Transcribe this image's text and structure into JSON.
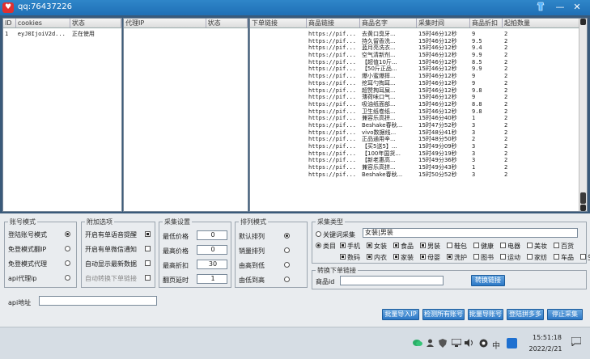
{
  "window": {
    "title": "qq:76437226",
    "logo": "♥"
  },
  "account_grid": {
    "headers": [
      "ID",
      "cookies",
      "状态"
    ],
    "rows": [
      [
        "1",
        "eyJ0IjoiV2d...",
        "正在使用"
      ]
    ]
  },
  "proxy_grid": {
    "headers": [
      "代理IP",
      "状态"
    ]
  },
  "product_grid": {
    "headers": [
      "下单链接",
      "商品链接",
      "商品名字",
      "采集时间",
      "商品折扣",
      "起拍数量"
    ],
    "rows": [
      [
        "",
        "https://pif...",
        "去黄口臭牙...",
        "15时46分12秒",
        "9",
        "2"
      ],
      [
        "",
        "https://pif...",
        "持久留香洗...",
        "15时46分12秒",
        "9.5",
        "2"
      ],
      [
        "",
        "https://pif...",
        "蓝月亮洗衣...",
        "15时46分12秒",
        "9.4",
        "2"
      ],
      [
        "",
        "https://pif...",
        "空气清新剂...",
        "15时46分12秒",
        "9.9",
        "2"
      ],
      [
        "",
        "https://pif...",
        "【超值10斤...",
        "15时46分12秒",
        "8.5",
        "2"
      ],
      [
        "",
        "https://pif...",
        "【50斤正品...",
        "15时46分12秒",
        "9.9",
        "2"
      ],
      [
        "",
        "https://pif...",
        "爆小蜜爆摔...",
        "15时46分12秒",
        "9",
        "2"
      ],
      [
        "",
        "https://pif...",
        "挖耳勺掏耳...",
        "15时46分12秒",
        "9",
        "2"
      ],
      [
        "",
        "https://pif...",
        "超赞掏耳屎...",
        "15时46分12秒",
        "9.8",
        "2"
      ],
      [
        "",
        "https://pif...",
        "薄荷味口气...",
        "15时46分12秒",
        "9",
        "2"
      ],
      [
        "",
        "https://pif...",
        "吸油纸面部...",
        "15时46分12秒",
        "8.8",
        "2"
      ],
      [
        "",
        "https://pif...",
        "卫生纸卷纸...",
        "15时46分12秒",
        "9.8",
        "2"
      ],
      [
        "",
        "https://pif...",
        "兼容乐高拼...",
        "15时46分40秒",
        "1",
        "2"
      ],
      [
        "",
        "https://pif...",
        "Beshake春秋...",
        "15时47分52秒",
        "3",
        "2"
      ],
      [
        "",
        "https://pif...",
        "vivo数据线...",
        "15时48分41秒",
        "3",
        "2"
      ],
      [
        "",
        "https://pif...",
        "正品通用辛...",
        "15时48分50秒",
        "2",
        "2"
      ],
      [
        "",
        "https://pif...",
        "【买5送5】...",
        "15时49分09秒",
        "3",
        "2"
      ],
      [
        "",
        "https://pif...",
        "【100年国货...",
        "15时49分19秒",
        "3",
        "2"
      ],
      [
        "",
        "https://pif...",
        "【新老惠高...",
        "15时49分36秒",
        "3",
        "2"
      ],
      [
        "",
        "https://pif...",
        "兼容乐高拼...",
        "15时49分43秒",
        "1",
        "2"
      ],
      [
        "",
        "https://pif...",
        "Beshake春秋...",
        "15时50分52秒",
        "3",
        "2"
      ]
    ]
  },
  "account_mode": {
    "legend": "账号模式",
    "options": [
      {
        "label": "登陆账号模式",
        "checked": true
      },
      {
        "label": "免登模式翻IP",
        "checked": false
      },
      {
        "label": "免登模式代理",
        "checked": false
      },
      {
        "label": "api代理ip",
        "checked": false
      }
    ],
    "api_label": "api地址",
    "api_value": ""
  },
  "extra_options": {
    "legend": "附加选项",
    "options": [
      {
        "label": "开启有单语音提醒",
        "checked": true
      },
      {
        "label": "开启有单微信通知",
        "checked": false
      },
      {
        "label": "自动显示最新数据",
        "checked": false
      },
      {
        "label": "自动转换下单链接",
        "checked": false
      }
    ]
  },
  "collect_settings": {
    "legend": "采集设置",
    "fields": [
      {
        "label": "最低价格",
        "value": "0"
      },
      {
        "label": "最高价格",
        "value": "0"
      },
      {
        "label": "最高折扣",
        "value": "30"
      },
      {
        "label": "翻页延时",
        "value": "1"
      }
    ]
  },
  "sort_mode": {
    "legend": "排列模式",
    "options": [
      {
        "label": "默认排列",
        "checked": true
      },
      {
        "label": "销量排列",
        "checked": false
      },
      {
        "label": "由高到低",
        "checked": false
      },
      {
        "label": "由低到高",
        "checked": false
      }
    ]
  },
  "collect_type": {
    "legend": "采集类型",
    "keyword_label": "关键词采集",
    "keyword_value": "女装|男装",
    "category_label": "类目",
    "categories": [
      "手机",
      "女装",
      "食品",
      "男装",
      "鞋包",
      "健康",
      "电器",
      "美妆",
      "百货",
      "数码",
      "内衣",
      "家装",
      "母婴",
      "洗护",
      "图书",
      "运动",
      "家纺",
      "车品",
      "生鲜"
    ],
    "checked_categories": [
      "手机",
      "女装",
      "食品",
      "男装",
      "数码",
      "内衣",
      "家装",
      "母婴",
      "洗护"
    ]
  },
  "convert_link": {
    "legend": "转换下单链接",
    "label": "商品id",
    "value": "",
    "button": "转换链接"
  },
  "buttons": {
    "import_ip": "批量导入IP",
    "check_accounts": "检测所有账号",
    "import_accounts": "批量导账号",
    "login_pdd": "登陆拼多多",
    "stop_collect": "停止采集"
  },
  "taskbar": {
    "time": "15:51:18",
    "date": "2022/2/21",
    "ime": "中",
    "tray_icons": [
      "wechat-icon",
      "people-icon",
      "shield-icon",
      "network-icon",
      "volume-icon",
      "record-icon"
    ]
  }
}
